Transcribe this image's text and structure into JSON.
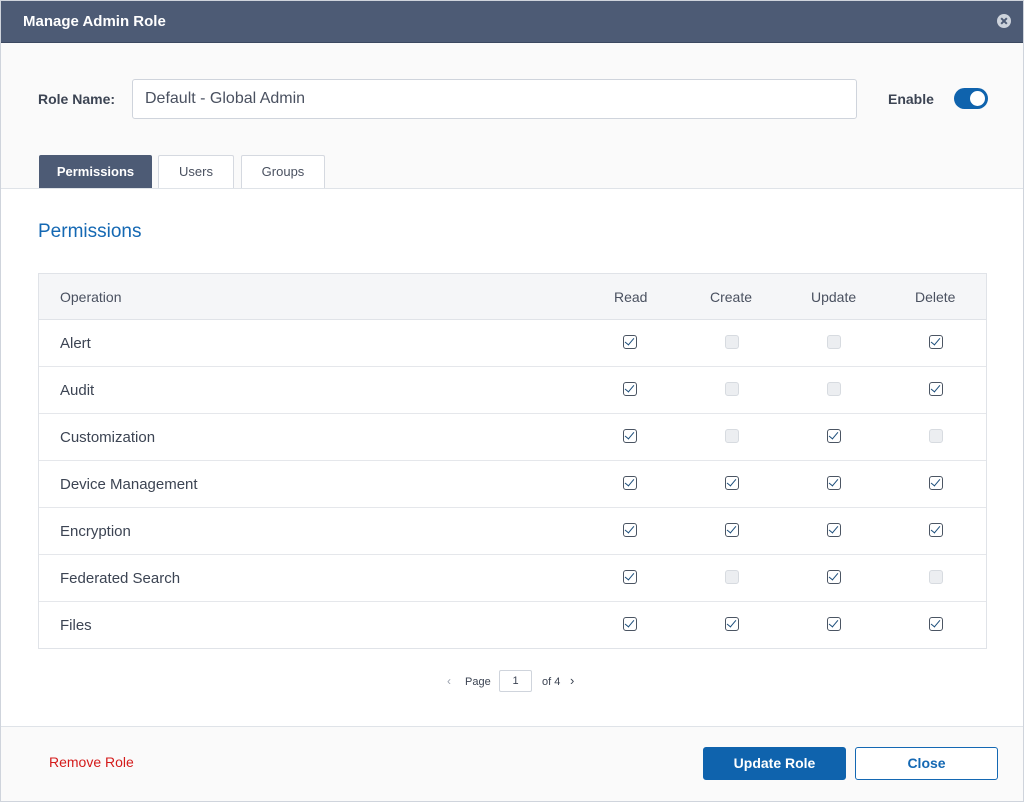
{
  "dialog": {
    "title": "Manage Admin Role"
  },
  "role": {
    "label": "Role Name:",
    "value": "Default - Global Admin",
    "enable_label": "Enable",
    "enabled": true
  },
  "tabs": [
    {
      "label": "Permissions",
      "active": true
    },
    {
      "label": "Users",
      "active": false
    },
    {
      "label": "Groups",
      "active": false
    }
  ],
  "section_title": "Permissions",
  "table": {
    "columns": [
      "Operation",
      "Read",
      "Create",
      "Update",
      "Delete"
    ],
    "rows": [
      {
        "operation": "Alert",
        "read": true,
        "create": false,
        "update": false,
        "delete": true
      },
      {
        "operation": "Audit",
        "read": true,
        "create": false,
        "update": false,
        "delete": true
      },
      {
        "operation": "Customization",
        "read": true,
        "create": false,
        "update": true,
        "delete": false
      },
      {
        "operation": "Device Management",
        "read": true,
        "create": true,
        "update": true,
        "delete": true
      },
      {
        "operation": "Encryption",
        "read": true,
        "create": true,
        "update": true,
        "delete": true
      },
      {
        "operation": "Federated Search",
        "read": true,
        "create": false,
        "update": true,
        "delete": false
      },
      {
        "operation": "Files",
        "read": true,
        "create": true,
        "update": true,
        "delete": true
      }
    ]
  },
  "pagination": {
    "page_label": "Page",
    "current_page": "1",
    "of_label": "of 4"
  },
  "footer": {
    "remove_label": "Remove Role",
    "update_label": "Update Role",
    "close_label": "Close"
  },
  "colors": {
    "titlebar": "#4d5b75",
    "accent": "#0f63ad",
    "danger": "#d41b1b",
    "section_title": "#1468b3"
  }
}
